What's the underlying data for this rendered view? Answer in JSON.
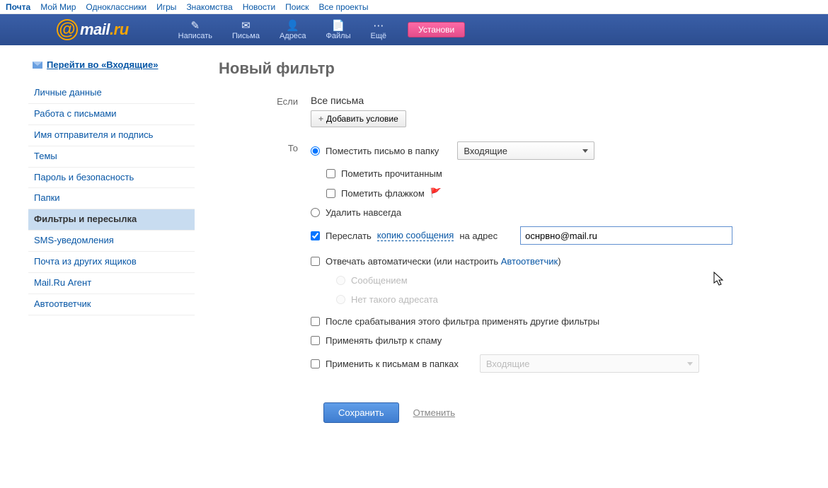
{
  "topnav": [
    "Почта",
    "Мой Мир",
    "Одноклассники",
    "Игры",
    "Знакомства",
    "Новости",
    "Поиск",
    "Все проекты"
  ],
  "header": {
    "logo_text": "mail",
    "logo_suffix": ".ru",
    "nav": [
      {
        "icon": "✎",
        "label": "Написать"
      },
      {
        "icon": "✉",
        "label": "Письма"
      },
      {
        "icon": "👤",
        "label": "Адреса"
      },
      {
        "icon": "📄",
        "label": "Файлы"
      },
      {
        "icon": "⋯",
        "label": "Ещё"
      }
    ],
    "install": "Установи"
  },
  "sidebar": {
    "goto_inbox": "Перейти во «Входящие»",
    "items": [
      "Личные данные",
      "Работа с письмами",
      "Имя отправителя и подпись",
      "Темы",
      "Пароль и безопасность",
      "Папки",
      "Фильтры и пересылка",
      "SMS-уведомления",
      "Почта из других ящиков",
      "Mail.Ru Агент",
      "Автоответчик"
    ],
    "active_index": 6
  },
  "main": {
    "title": "Новый фильтр",
    "if_label": "Если",
    "all_letters": "Все письма",
    "add_condition": "Добавить условие",
    "then_label": "То",
    "place_in_folder": "Поместить письмо в папку",
    "folder_value": "Входящие",
    "mark_read": "Пометить прочитанным",
    "mark_flag": "Пометить флажком",
    "delete_forever": "Удалить навсегда",
    "forward": "Переслать",
    "forward_link": "копию сообщения",
    "forward_suffix": "на адрес",
    "forward_email": "оснрвно@mail.ru",
    "autoreply_prefix": "Отвечать автоматически (или настроить ",
    "autoreply_link": "Автоответчик",
    "autoreply_suffix": ")",
    "autoreply_msg": "Сообщением",
    "autoreply_noaddr": "Нет такого адресата",
    "after_filter": "После срабатывания этого фильтра применять другие фильтры",
    "apply_spam": "Применять фильтр к спаму",
    "apply_folders": "Применить к письмам в папках",
    "apply_folders_value": "Входящие",
    "save": "Сохранить",
    "cancel": "Отменить"
  }
}
